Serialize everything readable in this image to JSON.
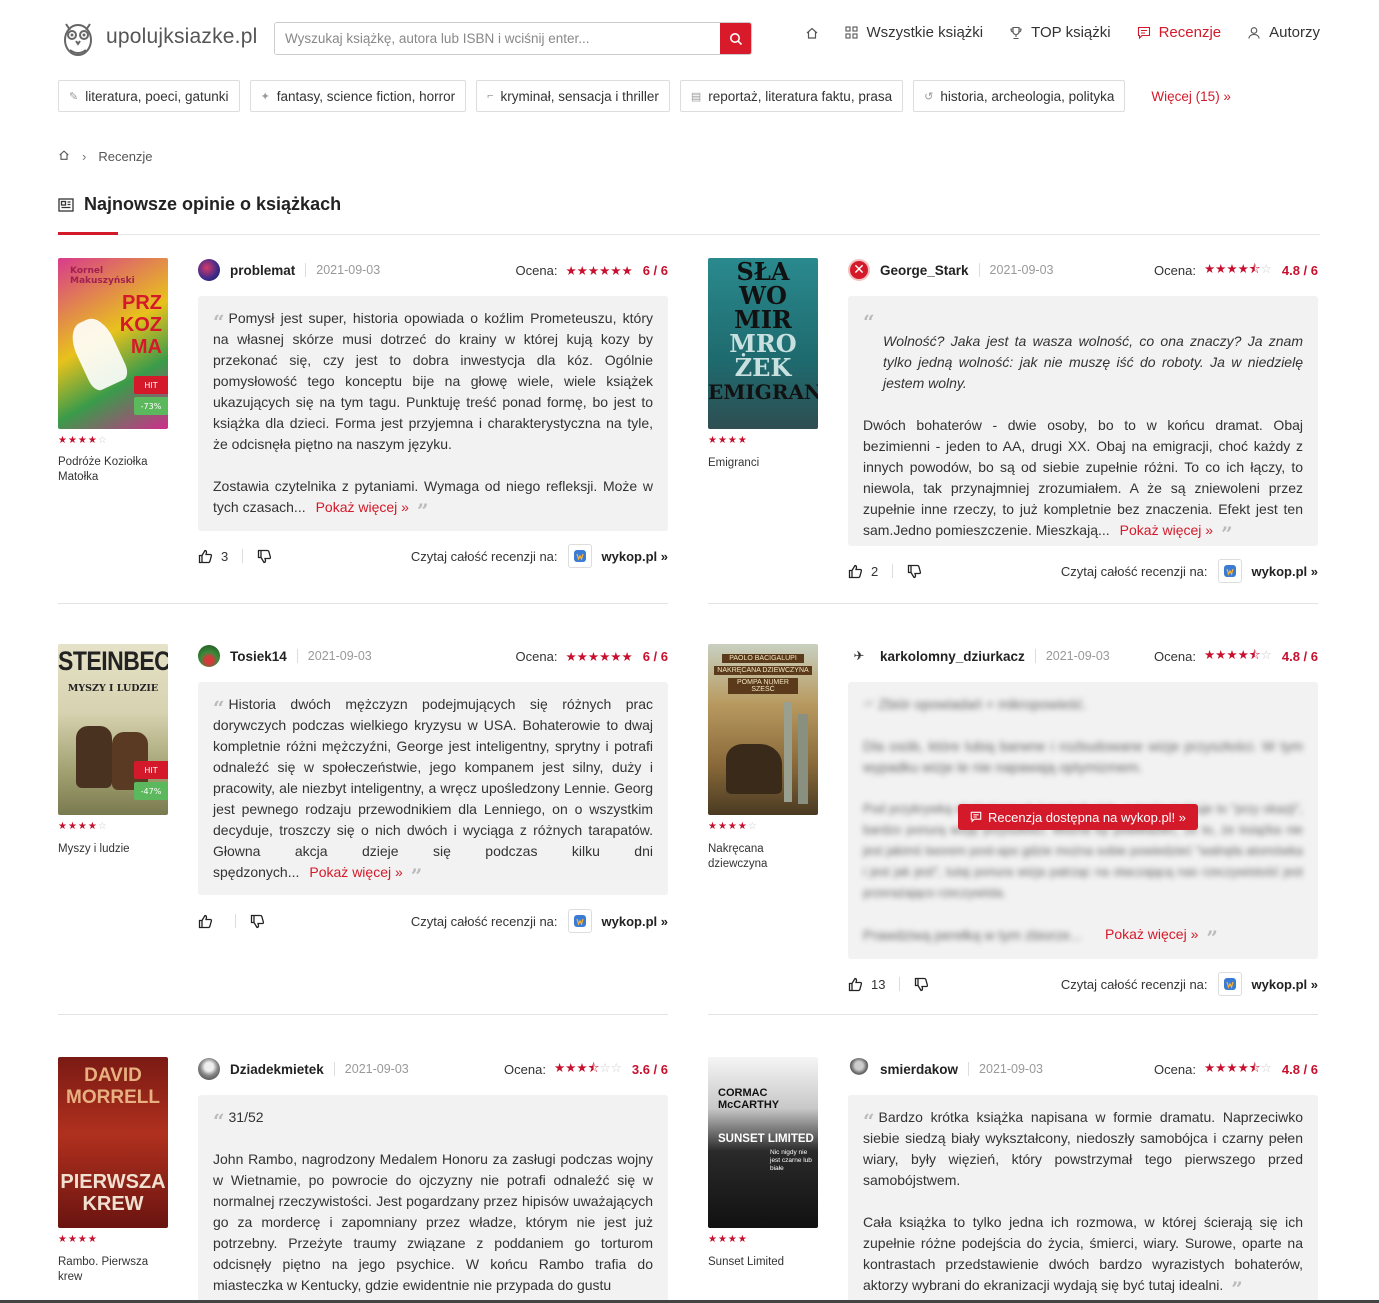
{
  "header": {
    "logo_text": "upolujksiazke.pl",
    "search_placeholder": "Wyszukaj książkę, autora lub ISBN i wciśnij enter...",
    "nav": [
      {
        "label": "Wszystkie książki"
      },
      {
        "label": "TOP książki"
      },
      {
        "label": "Recenzje"
      },
      {
        "label": "Autorzy"
      }
    ]
  },
  "categories": [
    {
      "label": "literatura, poeci, gatunki"
    },
    {
      "label": "fantasy, science fiction, horror"
    },
    {
      "label": "kryminał, sensacja i thriller"
    },
    {
      "label": "reportaż, literatura faktu, prasa"
    },
    {
      "label": "historia, archeologia, polityka"
    }
  ],
  "more_categories": "Więcej (15) »",
  "breadcrumb": {
    "current": "Recenzje"
  },
  "section_title": "Najnowsze opinie o książkach",
  "labels": {
    "rating": "Ocena:",
    "read_full": "Czytaj całość recenzji na:",
    "show_more": "Pokaż więcej »",
    "source": "wykop.pl »",
    "overlay": "Recenzja dostępna na wykop.pl! »"
  },
  "reviews": [
    {
      "book_title": "Podróże Koziołka Matołka",
      "book_stars": 3.5,
      "badges": {
        "hit": "HIT",
        "discount": "-73%"
      },
      "user": "problemat",
      "date": "2021-09-03",
      "rating": "6 / 6",
      "paragraphs": [
        "Pomysł jest super, historia opowiada o koźlim Prometeuszu, który na własnej skórze musi dotrzeć do krainy w której kują kozy by przekonać się, czy jest to dobra inwestycja dla kóz. Ogólnie pomysłowość tego konceptu bije na głowę wiele, wiele książek ukazujących się na tym tagu. Punktuję treść ponad formę, bo jest to książka dla dzieci. Forma jest przyjemna i charakterystyczna na tyle, że odcisnęła piętno na naszym języku.",
        "Zostawia czytelnika z pytaniami. Wymaga od niego refleksji. Może w tych czasach..."
      ],
      "likes": "3"
    },
    {
      "book_title": "Emigranci",
      "book_stars": 4,
      "user": "George_Stark",
      "date": "2021-09-03",
      "rating": "4.8 / 6",
      "quote": "Wolność? Jaka jest ta wasza wolność, co ona znaczy? Ja znam tylko jedną wolność: jak nie muszę iść do roboty. Ja w niedzielę jestem wolny.",
      "paragraphs": [
        "Dwóch bohaterów - dwie osoby, bo to w końcu dramat. Obaj bezimienni - jeden to AA, drugi XX. Obaj na emigracji, choć każdy z innych powodów, bo są od siebie zupełnie różni. To co ich łączy, to niewola, tak przynajmniej zrozumiałem. A że są zniewoleni przez zupełnie inne rzeczy, to już kompletnie bez znaczenia. Efekt jest ten sam.Jedno pomieszczenie. Mieszkają..."
      ],
      "likes": "2"
    },
    {
      "book_title": "Myszy i ludzie",
      "book_stars": 3.5,
      "badges": {
        "hit": "HIT",
        "discount": "-47%"
      },
      "user": "Tosiek14",
      "date": "2021-09-03",
      "rating": "6 / 6",
      "paragraphs": [
        "Historia dwóch mężczyzn podejmujących się różnych prac dorywczych podczas wielkiego kryzysu w USA. Bohaterowie to dwaj kompletnie różni mężczyźni, George jest inteligentny, sprytny i potrafi odnaleźć się w społeczeństwie, jego kompanem jest silny, duży i pracowity, ale niezbyt inteligentny, a wręcz upośledzony Lennie. Georg jest pewnego rodzaju przewodnikiem dla Lenniego, on o wszystkim decyduje, troszczy się o nich dwóch i wyciąga z różnych tarapatów. Głowna akcja dzieje się podczas kilku dni spędzonych..."
      ],
      "likes": ""
    },
    {
      "book_title": "Nakręcana dziewczyna",
      "book_stars": 3.5,
      "user": "karkolomny_dziurkacz",
      "date": "2021-09-03",
      "rating": "4.8 / 6",
      "blurred_paragraphs": [
        "Zbiór opowiadań + mikropowieść.",
        "Dla osób, które lubią barwne i rozbudowane wizje przyszłości. W tym wypadku wizje te nie napawają optymizmem.",
        "Pod przykrywką ekologicznych katastrof wielu autorów traktuje to \"przy okazji\", bardzo ponurą wizję przyszłości. Można by powiedzieć, że to, że książka nie jest jakimś tworem post-apo gdzie można sobie powiedzieć \"walnęła atomówka i jest jak jest\", tutaj ponura wizja patrząc na otaczającą nas rzeczywistość jest przerażająco rzeczywista.",
        "Prawdziwą perełką w tym zbiorze..."
      ],
      "likes": "13"
    },
    {
      "book_title": "Rambo. Pierwsza krew",
      "book_stars": 4,
      "user": "Dziadekmietek",
      "date": "2021-09-03",
      "rating": "3.6 / 6",
      "paragraphs": [
        "31/52",
        "John Rambo, nagrodzony Medalem Honoru za zasługi podczas wojny w Wietnamie, po powrocie do ojczyzny nie potrafi odnaleźć się w normalnej rzeczywistości. Jest pogardzany przez hipisów uważających go za mordercę i zapomniany przez władze, którym nie jest już potrzebny. Przeżyte traumy związane z poddaniem go torturom odcisnęły piętno na jego psychice. W końcu Rambo trafia do miasteczka w Kentucky, gdzie ewidentnie nie przypada do gustu"
      ],
      "likes": ""
    },
    {
      "book_title": "Sunset Limited",
      "book_stars": 4,
      "user": "smierdakow",
      "date": "2021-09-03",
      "rating": "4.8 / 6",
      "paragraphs": [
        "Bardzo krótka książka napisana w formie dramatu. Naprzeciwko siebie siedzą biały wykształcony, niedoszły samobójca i czarny pełen wiary, były więzień, który powstrzymał tego pierwszego przed samobójstwem.",
        "Cała książka to tylko jedna ich rozmowa, w której ścierają się ich zupełnie różne podejścia do życia, śmierci, wiary. Surowe, oparte na kontrastach przedstawienie dwóch bardzo wyrazistych bohaterów, aktorzy wybrani do ekranizacji wydają się być tutaj idealni."
      ],
      "likes": ""
    }
  ],
  "covers": [
    {
      "lines": [
        "PRZ",
        "KOZ",
        "MA"
      ]
    },
    {
      "lines": [
        "SŁA",
        "WO",
        "MIR",
        "MRO",
        "ŻEK",
        "EMIGRANCI"
      ]
    },
    {
      "lines": [
        "STEINBECK",
        "MYSZY I LUDZIE"
      ]
    },
    {
      "lines": [
        "PAOLO BACIGALUPI",
        "NAKRĘCANA DZIEWCZYNA",
        "POMPA NUMER SZEŚĆ"
      ]
    },
    {
      "lines": [
        "DAVID",
        "MORRELL",
        "PIERWSZA",
        "KREW"
      ]
    },
    {
      "lines": [
        "CORMAC",
        "McCARTHY",
        "SUNSET LIMITED",
        "Nic nigdy nie jest czarne lub białe"
      ]
    }
  ]
}
